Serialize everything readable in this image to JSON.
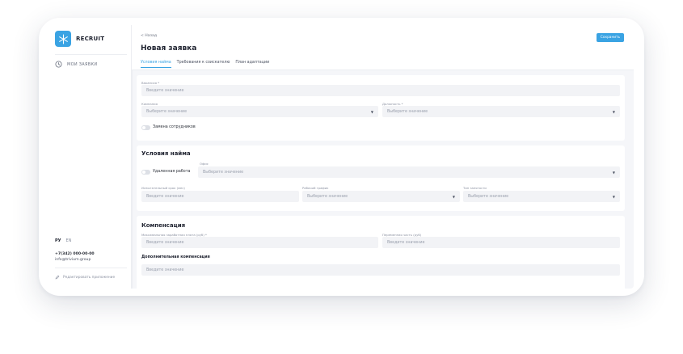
{
  "brand": {
    "name": "RECRUIT"
  },
  "sidebar": {
    "nav": [
      {
        "label": "МОИ ЗАЯВКИ",
        "icon": "clock-icon"
      }
    ],
    "lang": {
      "active": "РУ",
      "inactive": "EN"
    },
    "contact": {
      "phone": "+7(342) 000-00-00",
      "email": "info@trivium.group"
    },
    "edit_app": "Редактировать приложение"
  },
  "header": {
    "back": "< Назад",
    "title": "Новая заявка",
    "save": "Сохранить"
  },
  "tabs": [
    {
      "label": "Условия найма",
      "active": true
    },
    {
      "label": "Требования к соискателю",
      "active": false
    },
    {
      "label": "План адаптации",
      "active": false
    }
  ],
  "form": {
    "card1": {
      "vacancy": {
        "label": "Вакансия *",
        "placeholder": "Введите значение"
      },
      "company": {
        "label": "Компания",
        "placeholder": "Выберите значение"
      },
      "position": {
        "label": "Должность *",
        "placeholder": "Выберите значение"
      },
      "replacement": {
        "label": "Замена сотрудников"
      }
    },
    "card2": {
      "title": "Условия найма",
      "remote": {
        "label": "Удаленная работа"
      },
      "office": {
        "label": "Офис",
        "placeholder": "Выберите значение"
      },
      "probation": {
        "label": "Испытательный срок (мес)",
        "placeholder": "Введите значение"
      },
      "schedule": {
        "label": "Рабочий график",
        "placeholder": "Выберите значение"
      },
      "employment": {
        "label": "Тип занятости",
        "placeholder": "Выберите значение"
      }
    },
    "card3": {
      "title": "Компенсация",
      "max_salary": {
        "label": "Максимальная заработная плата (руб) *",
        "placeholder": "Введите значение"
      },
      "variable": {
        "label": "Переменная часть (руб)",
        "placeholder": "Введите значение"
      },
      "extra_title": "Дополнительная компенсация",
      "extra": {
        "placeholder": "Введите значение"
      }
    }
  },
  "colors": {
    "accent": "#3aa3e3",
    "background": "#f5f6f9"
  }
}
